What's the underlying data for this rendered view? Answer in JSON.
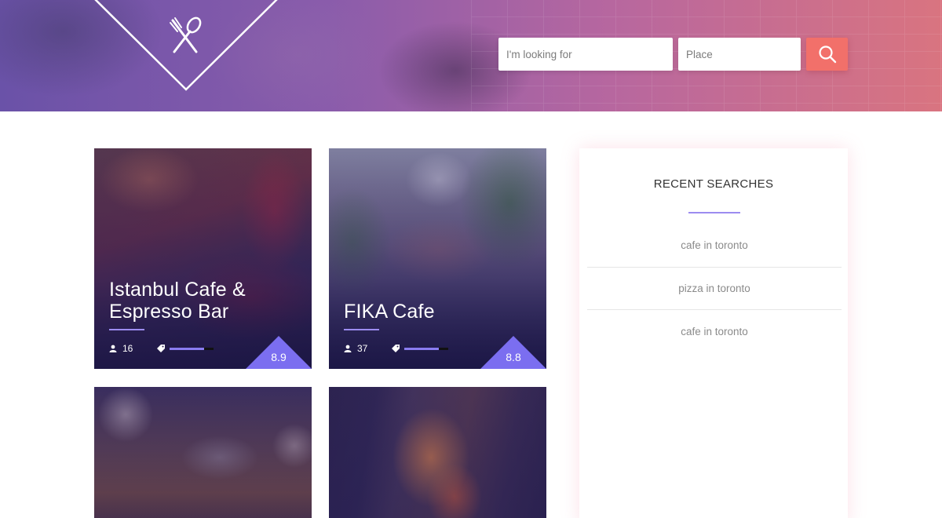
{
  "header": {
    "logo_icon": "fork-and-spoon-icon",
    "search": {
      "query_placeholder": "I'm looking for",
      "query_value": "",
      "place_placeholder": "Place",
      "place_value": "",
      "button_icon": "search-icon"
    }
  },
  "cards": [
    {
      "title": "Istanbul Cafe & Espresso Bar",
      "reviewers": "16",
      "price_level": 0.78,
      "score": "8.9"
    },
    {
      "title": "FIKA Cafe",
      "reviewers": "37",
      "price_level": 0.78,
      "score": "8.8"
    },
    {
      "title": "",
      "reviewers": "",
      "score": ""
    },
    {
      "title": "",
      "reviewers": "",
      "score": ""
    }
  ],
  "sidebar": {
    "title": "RECENT SEARCHES",
    "items": [
      {
        "label": "cafe in toronto"
      },
      {
        "label": "pizza in toronto"
      },
      {
        "label": "cafe in toronto"
      }
    ]
  },
  "colors": {
    "accent": "#9c8cf0",
    "score_badge": "#7b6ef0",
    "search_button": "#f2706a",
    "header_gradient_start": "#6a52a8",
    "header_gradient_end": "#d97480"
  }
}
